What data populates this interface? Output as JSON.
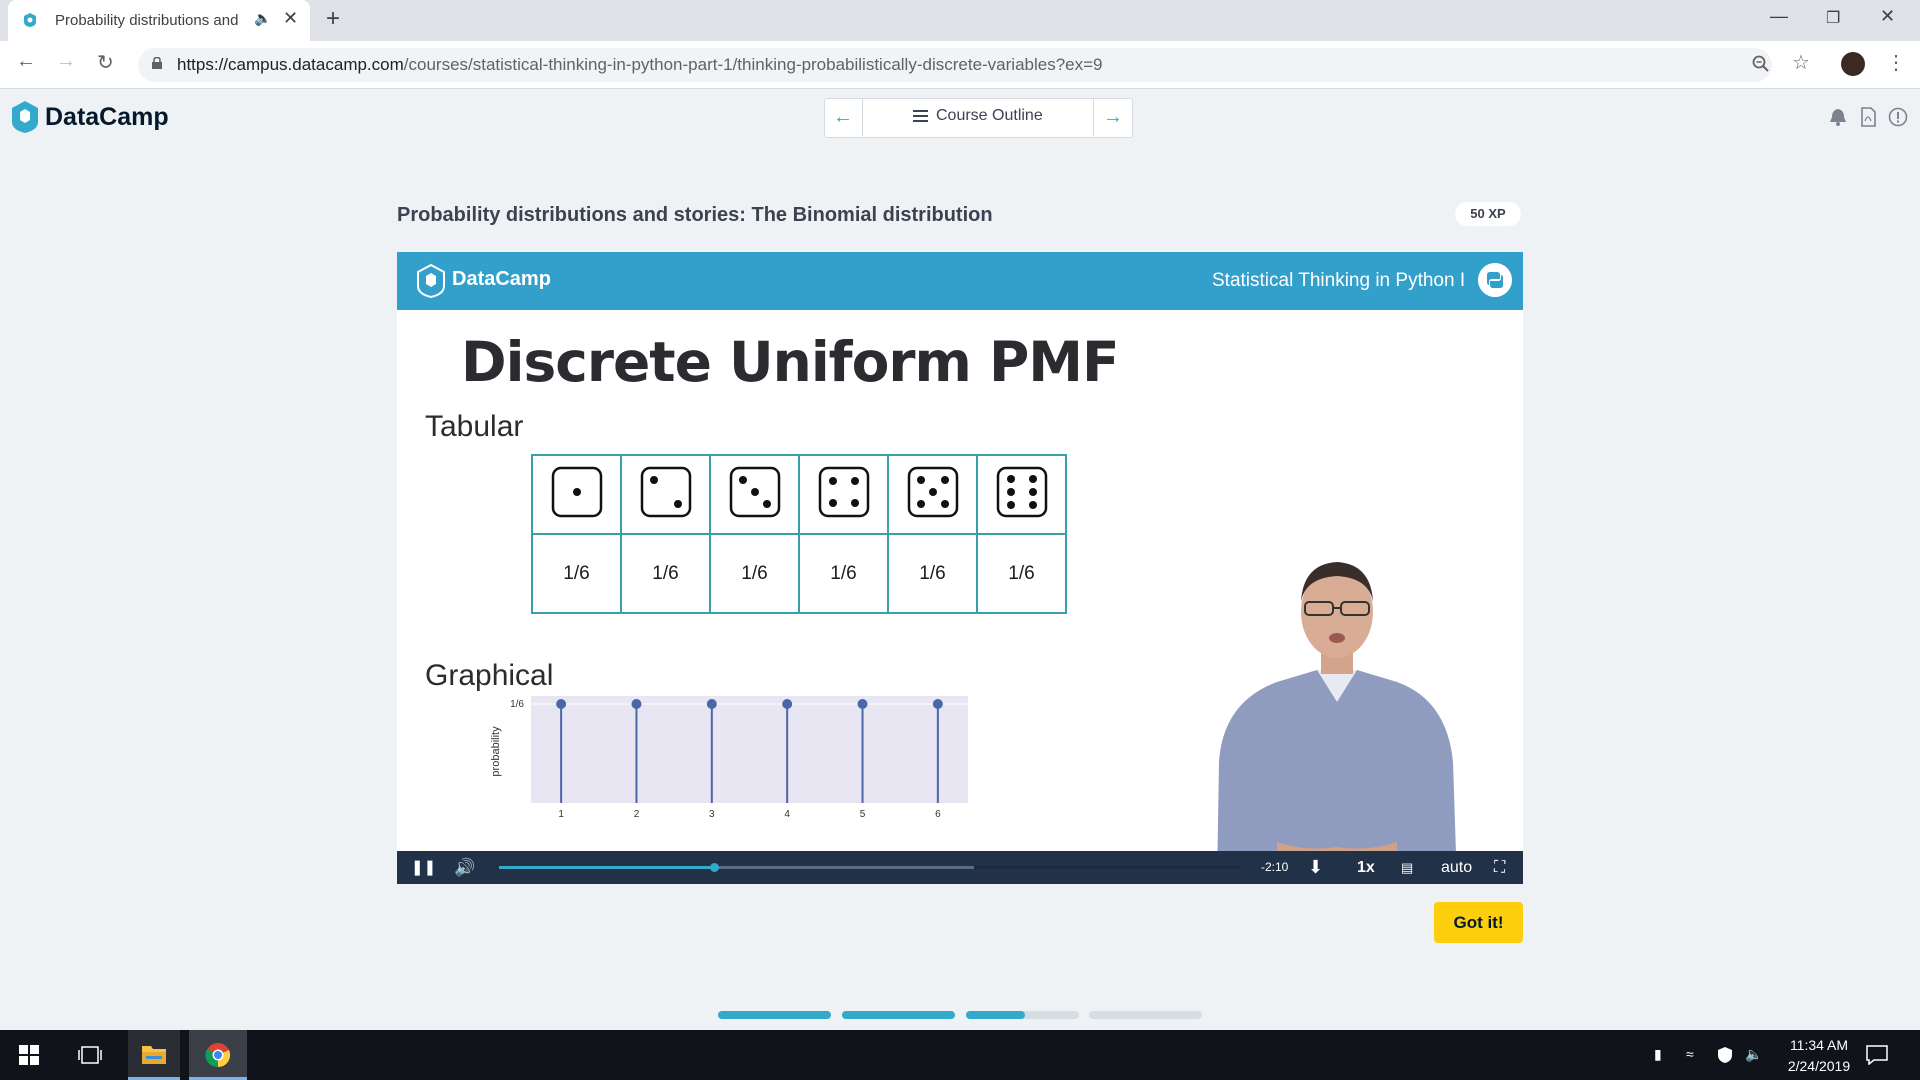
{
  "browser": {
    "tab_title": "Probability distributions and",
    "url_host": "https://campus.datacamp.com",
    "url_path": "/courses/statistical-thinking-in-python-part-1/thinking-probabilistically-discrete-variables?ex=9"
  },
  "header": {
    "logo_text": "DataCamp",
    "course_outline": "Course Outline"
  },
  "exercise": {
    "title": "Probability distributions and stories: The Binomial distribution",
    "xp": "50 XP",
    "got_it": "Got it!"
  },
  "slide": {
    "logo_text": "DataCamp",
    "course_name": "Statistical Thinking in Python I",
    "title": "Discrete Uniform PMF",
    "tabular_label": "Tabular",
    "graphical_label": "Graphical",
    "table_probs": [
      "1/6",
      "1/6",
      "1/6",
      "1/6",
      "1/6",
      "1/6"
    ],
    "dice_faces": [
      1,
      2,
      3,
      4,
      5,
      6
    ]
  },
  "chart_data": {
    "type": "stem",
    "x": [
      1,
      2,
      3,
      4,
      5,
      6
    ],
    "y": [
      0.1667,
      0.1667,
      0.1667,
      0.1667,
      0.1667,
      0.1667
    ],
    "x_tick_labels": [
      "1",
      "2",
      "3",
      "4",
      "5",
      "6"
    ],
    "y_tick_labels": [
      "1/6"
    ],
    "ylabel": "probability",
    "ylim": [
      0,
      0.1667
    ],
    "color": "#4a67a8",
    "plot_background": "#e8e6f3"
  },
  "player": {
    "time_remaining": "-2:10",
    "speed": "1x",
    "quality": "auto",
    "progress_played": 0.29,
    "progress_buffered": 0.64
  },
  "lesson_progress": [
    1.0,
    1.0,
    0.52,
    0.0
  ],
  "taskbar": {
    "time": "11:34 AM",
    "date": "2/24/2019"
  },
  "colors": {
    "accent": "#33aacc",
    "got_it": "#fcce0d",
    "slide_header": "#33a0cc",
    "player_bar": "#213147"
  }
}
